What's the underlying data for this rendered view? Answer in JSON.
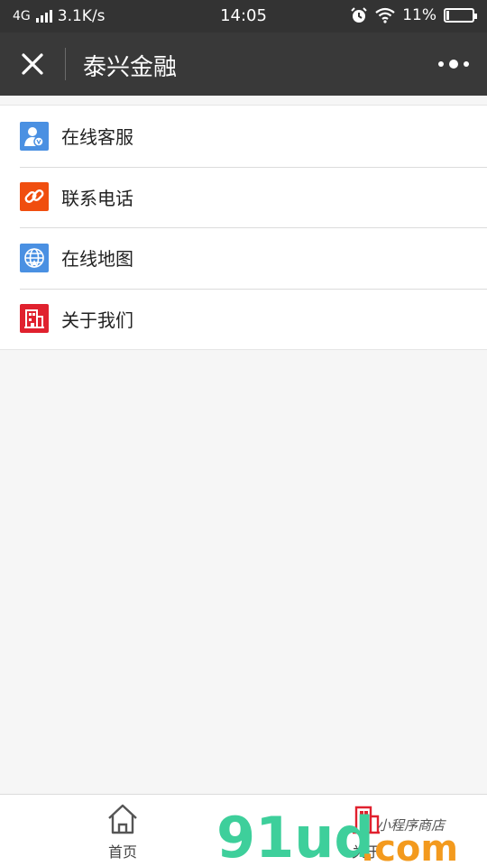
{
  "status_bar": {
    "network": "4G",
    "speed": "3.1K/s",
    "time": "14:05",
    "battery": "11%",
    "battery_level": 0.11
  },
  "nav": {
    "title": "泰兴金融",
    "close_icon": "close-icon",
    "more_icon": "more-icon"
  },
  "menu": {
    "items": [
      {
        "label": "在线客服",
        "icon": "customer-service-icon",
        "color": "#4a90e2"
      },
      {
        "label": "联系电话",
        "icon": "link-icon",
        "color": "#f04e0f"
      },
      {
        "label": "在线地图",
        "icon": "globe-icon",
        "color": "#4a90e2"
      },
      {
        "label": "关于我们",
        "icon": "building-icon",
        "color": "#e0212e"
      }
    ]
  },
  "tabbar": {
    "tabs": [
      {
        "label": "首页",
        "icon": "home-icon"
      },
      {
        "label": "关于",
        "icon": "building-icon"
      }
    ]
  },
  "watermark": {
    "brand": "91ud",
    "suffix": ".com",
    "tagline": "小程序商店"
  }
}
